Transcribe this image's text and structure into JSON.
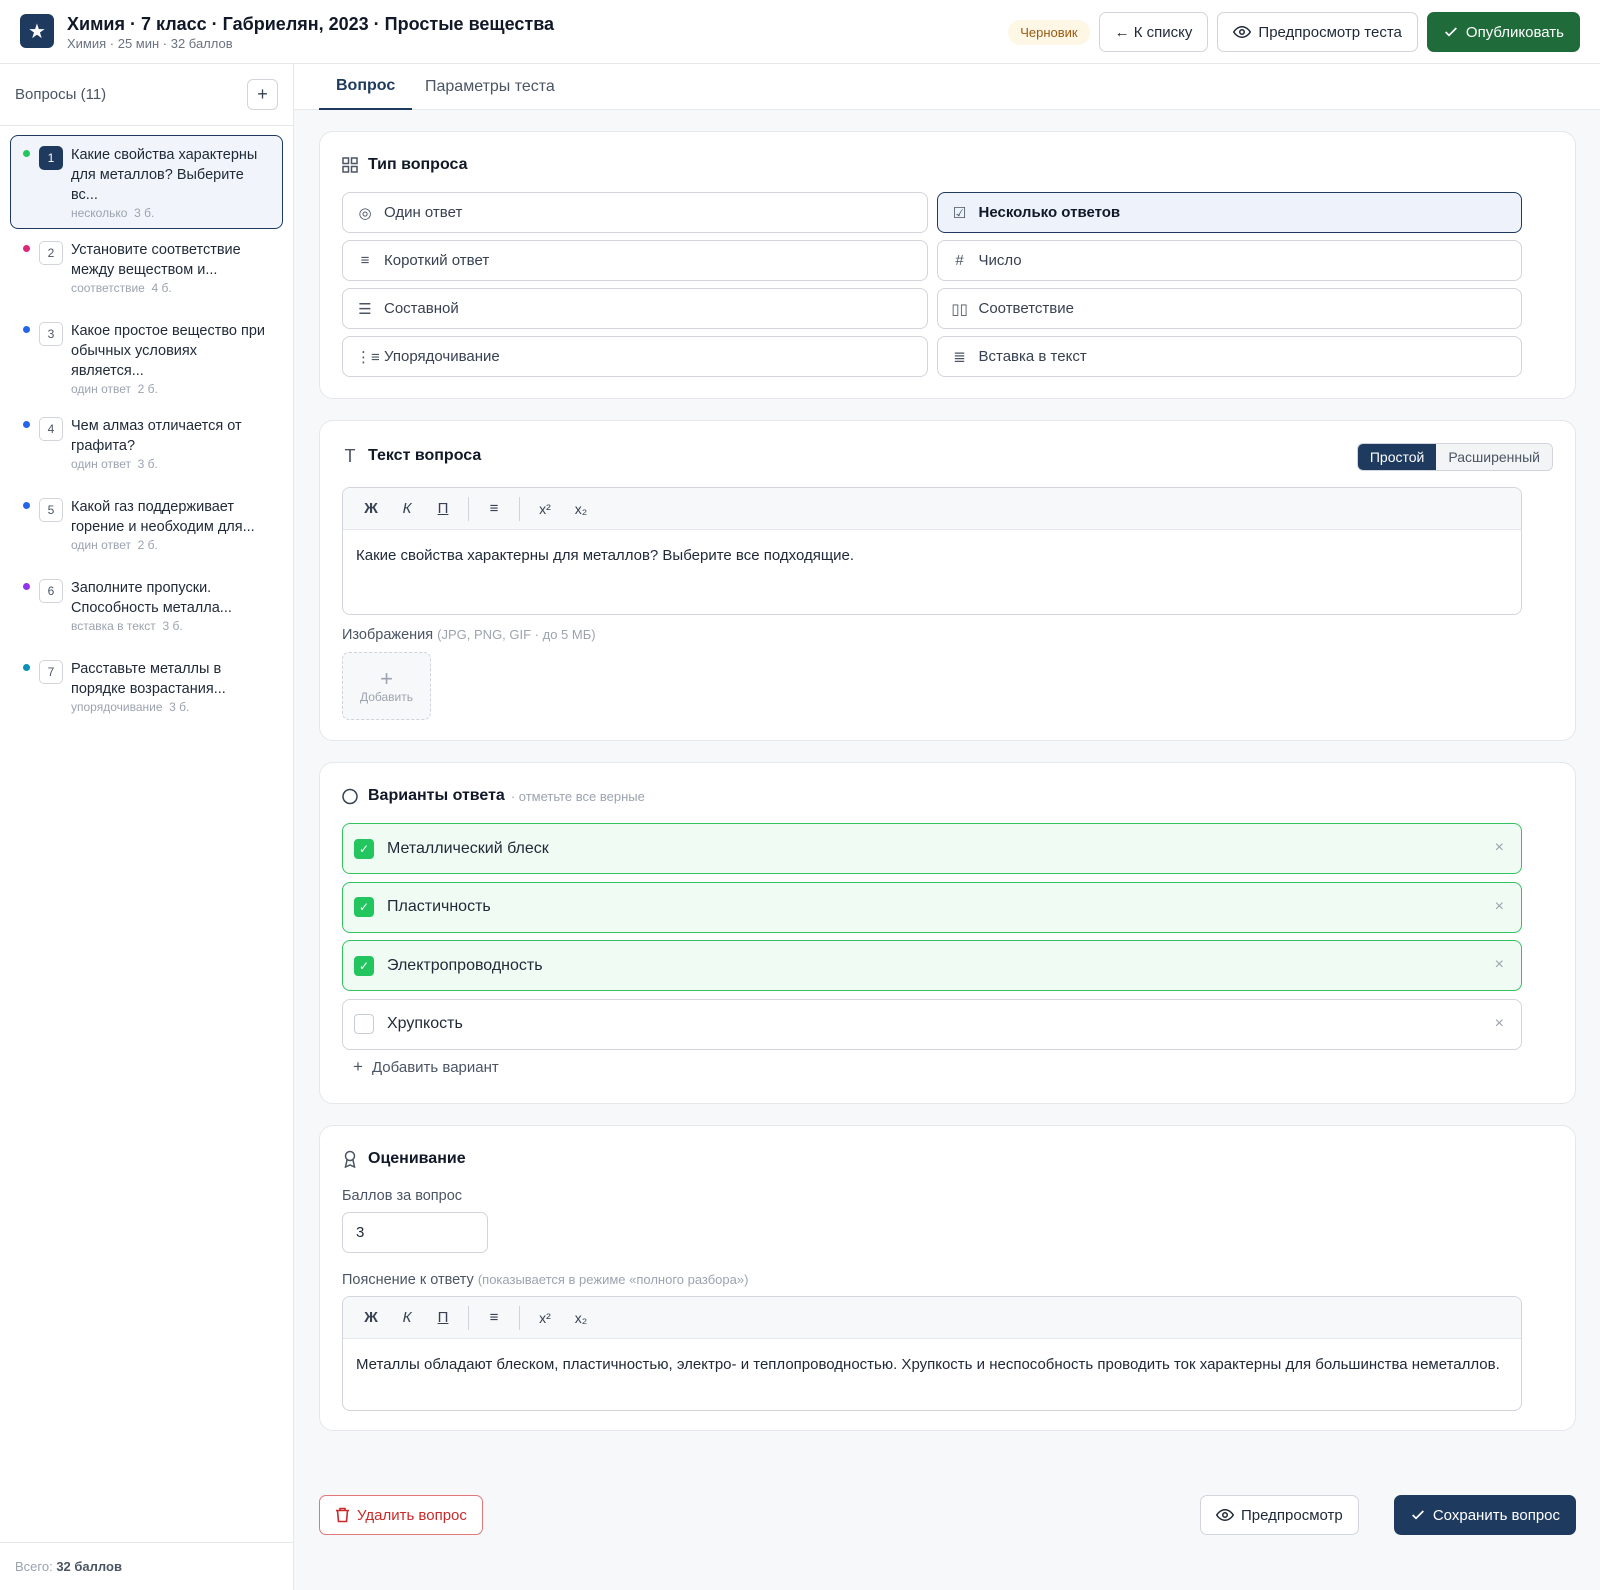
{
  "header": {
    "logo_glyph": "★",
    "title": "Химия · 7 класс · Габриелян, 2023 · Простые вещества",
    "subtitle": "Химия · 25 мин · 32 баллов",
    "status_badge": "Черновик",
    "back_label": "← К списку",
    "preview_test_label": "Предпросмотр теста",
    "publish_label": "Опубликовать"
  },
  "sidebar": {
    "title": "Вопросы (11)",
    "add_label": "+",
    "items": [
      {
        "num": "1",
        "text": "Какие свойства характерны для металлов? Выберите вс...",
        "type": "несколько",
        "points": "3 б.",
        "color": "#22c55e"
      },
      {
        "num": "2",
        "text": "Установите соответствие между веществом и...",
        "type": "соответствие",
        "points": "4 б.",
        "color": "#db2777"
      },
      {
        "num": "3",
        "text": "Какое простое вещество при обычных условиях является...",
        "type": "один ответ",
        "points": "2 б.",
        "color": "#2563eb"
      },
      {
        "num": "4",
        "text": "Чем алмаз отличается от графита?",
        "type": "один ответ",
        "points": "3 б.",
        "color": "#2563eb"
      },
      {
        "num": "5",
        "text": "Какой газ поддерживает горение и необходим для...",
        "type": "один ответ",
        "points": "2 б.",
        "color": "#2563eb"
      },
      {
        "num": "6",
        "text": "Заполните пропуски. Способность металла...",
        "type": "вставка в текст",
        "points": "3 б.",
        "color": "#9333ea"
      },
      {
        "num": "7",
        "text": "Расставьте металлы в порядке возрастания...",
        "type": "упорядочивание",
        "points": "3 б.",
        "color": "#0891b2"
      }
    ],
    "footer_prefix": "Всего:",
    "footer_total": "32 баллов"
  },
  "tabs": [
    {
      "label": "Вопрос"
    },
    {
      "label": "Параметры теста"
    }
  ],
  "question_type": {
    "title": "Тип вопроса",
    "options": [
      {
        "label": "Один ответ",
        "icon": "◎"
      },
      {
        "label": "Несколько ответов",
        "icon": "☑"
      },
      {
        "label": "Короткий ответ",
        "icon": "≡"
      },
      {
        "label": "Число",
        "icon": "#"
      },
      {
        "label": "Составной",
        "icon": "☰"
      },
      {
        "label": "Соответствие",
        "icon": "▯▯"
      },
      {
        "label": "Упорядочивание",
        "icon": "⋮≡"
      },
      {
        "label": "Вставка в текст",
        "icon": "≣"
      }
    ],
    "selected": "Несколько ответов"
  },
  "question_text": {
    "title": "Текст вопроса",
    "mode_simple": "Простой",
    "mode_advanced": "Расширенный",
    "toolbar": {
      "bold": "Ж",
      "italic": "К",
      "underline": "П",
      "list": "≡",
      "sup": "x²",
      "sub": "x₂"
    },
    "body": "Какие свойства характерны для металлов? Выберите все подходящие.",
    "images_label": "Изображения",
    "images_hint": "(JPG, PNG, GIF · до 5 МБ)",
    "upload_plus": "+",
    "upload_label": "Добавить"
  },
  "answers": {
    "title": "Варианты ответа",
    "hint": "· отметьте все верные",
    "check_glyph": "✓",
    "remove_glyph": "×",
    "options": [
      {
        "label": "Металлический блеск",
        "correct": true
      },
      {
        "label": "Пластичность",
        "correct": true
      },
      {
        "label": "Электропроводность",
        "correct": true
      },
      {
        "label": "Хрупкость",
        "correct": false
      }
    ],
    "add_label": "Добавить вариант"
  },
  "grading": {
    "title": "Оценивание",
    "points_label": "Баллов за вопрос",
    "points_value": "3",
    "explanation_label": "Пояснение к ответу",
    "explanation_hint": "(показывается в режиме «полного разбора»)",
    "explanation_body": "Металлы обладают блеском, пластичностью, электро- и теплопроводностью. Хрупкость и неспособность проводить ток характерны для большинства неметаллов."
  },
  "footer": {
    "delete_label": "Удалить вопрос",
    "preview_label": "Предпросмотр",
    "save_label": "Сохранить вопрос"
  },
  "colors": {
    "navy": "#1e3a5f",
    "publish_green": "#1f6b3a",
    "correct_green": "#22c55e",
    "danger": "#c92a2a"
  }
}
